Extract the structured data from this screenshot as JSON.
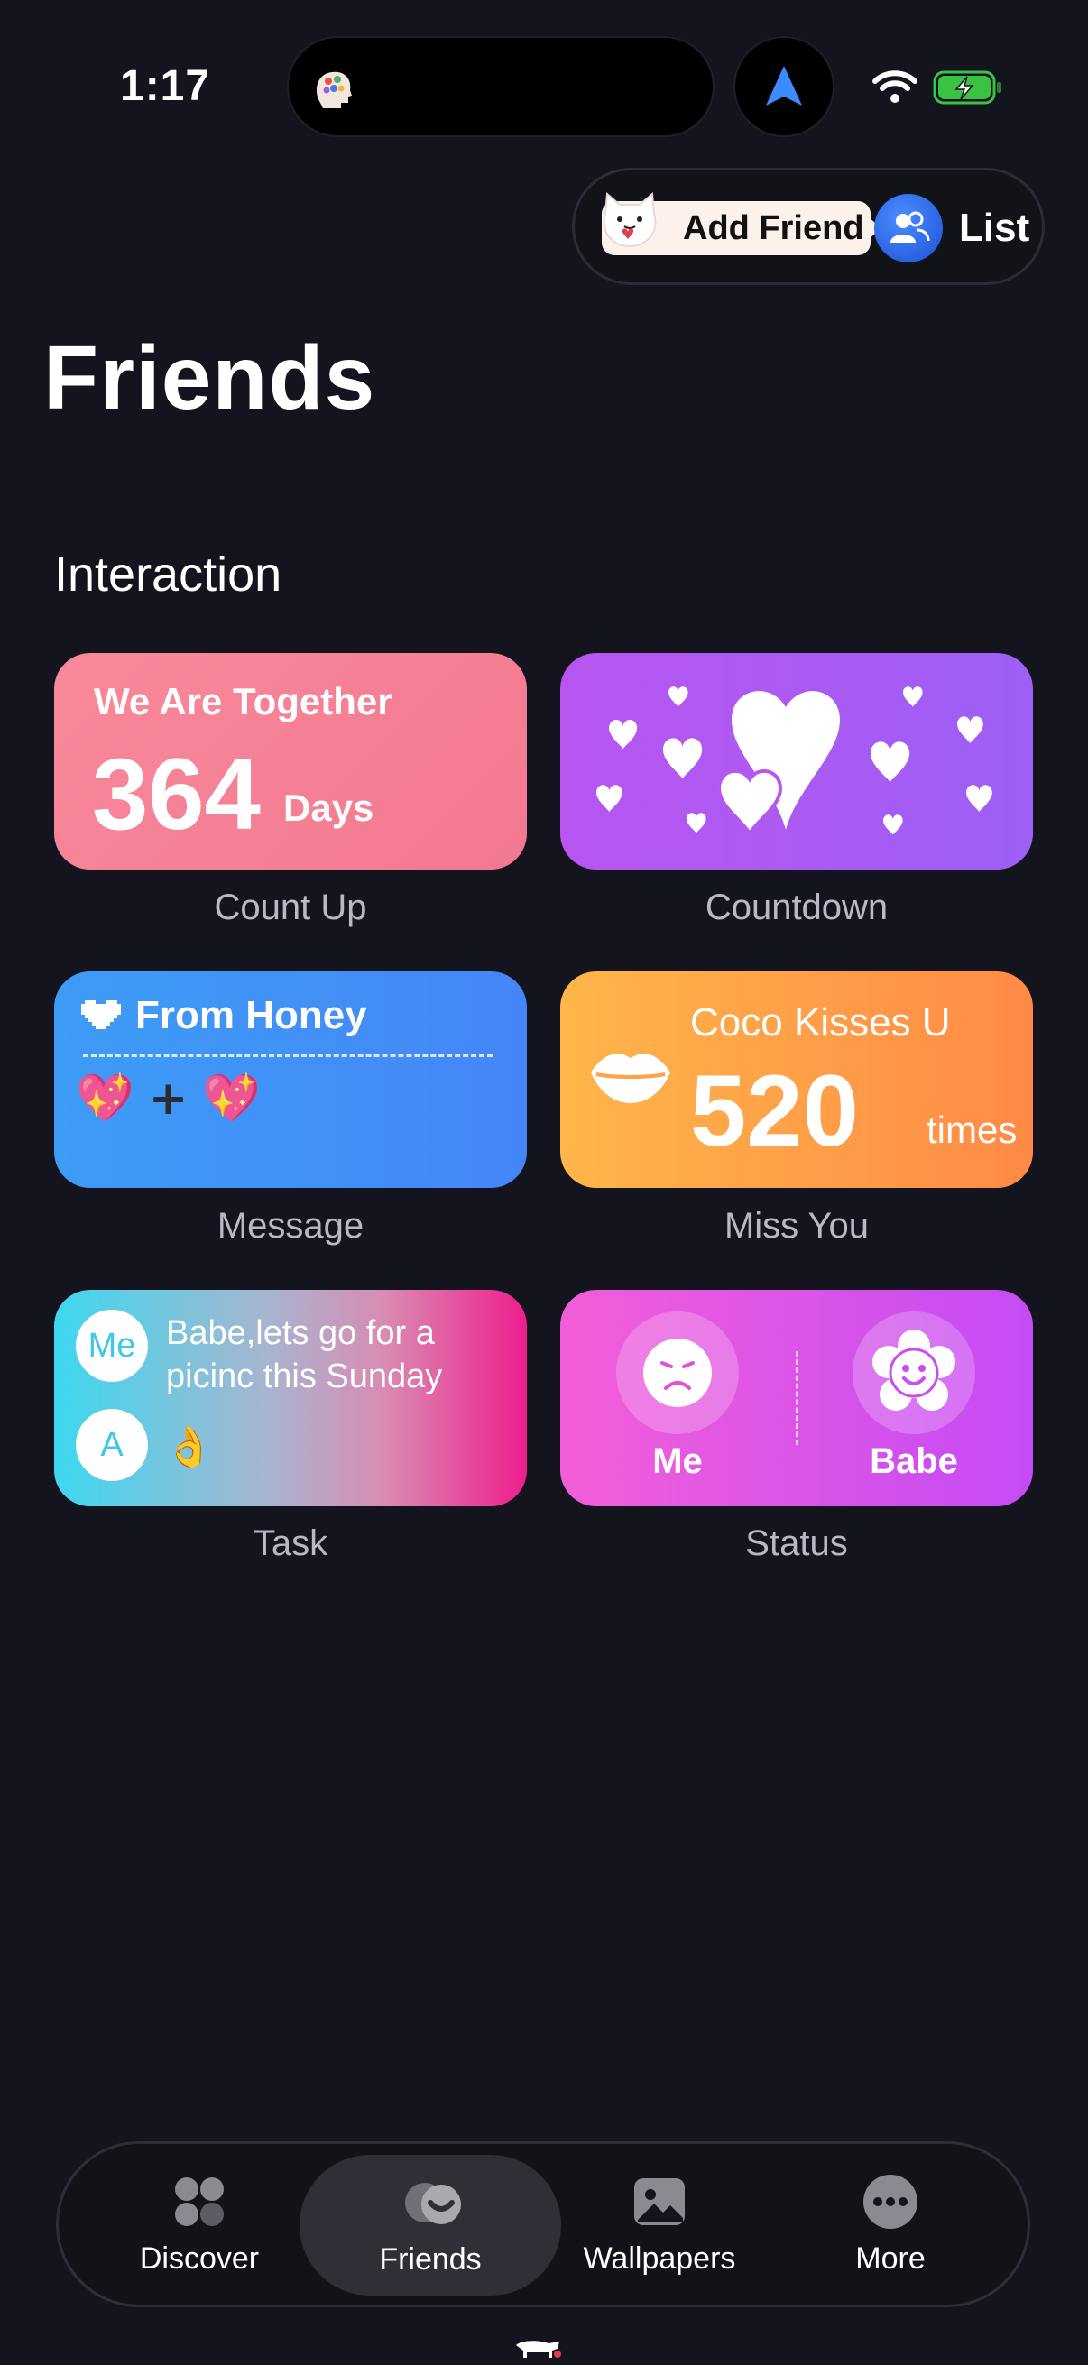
{
  "status_bar": {
    "time": "1:17"
  },
  "top_actions": {
    "add_friend_label": "Add Friend",
    "list_label": "List"
  },
  "page": {
    "title": "Friends",
    "section_title": "Interaction"
  },
  "widgets": {
    "count_up": {
      "header": "We Are Together",
      "number": "364",
      "unit": "Days",
      "caption": "Count Up"
    },
    "countdown": {
      "caption": "Countdown"
    },
    "message": {
      "header": "From Honey",
      "emoji_left": "💖",
      "emoji_plus": "+",
      "emoji_right": "💖",
      "caption": "Message"
    },
    "miss_you": {
      "header": "Coco Kisses U",
      "number": "520",
      "unit": "times",
      "caption": "Miss You"
    },
    "task": {
      "avatar_me": "Me",
      "avatar_a": "A",
      "text": "Babe,lets go for a picinc this Sunday",
      "reply_emoji": "👌",
      "caption": "Task"
    },
    "status": {
      "left_label": "Me",
      "right_label": "Babe",
      "caption": "Status"
    }
  },
  "tabbar": {
    "tabs": [
      {
        "label": "Discover",
        "icon": "grid-icon"
      },
      {
        "label": "Friends",
        "icon": "friends-icon",
        "active": true
      },
      {
        "label": "Wallpapers",
        "icon": "image-icon"
      },
      {
        "label": "More",
        "icon": "more-dots-icon"
      }
    ]
  },
  "colors": {
    "background": "#14141f",
    "count_up": "#f7879a",
    "countdown": "#b05af2",
    "message": "#4192f6",
    "miss_you": "#ffa049",
    "status": "#e055e6"
  }
}
